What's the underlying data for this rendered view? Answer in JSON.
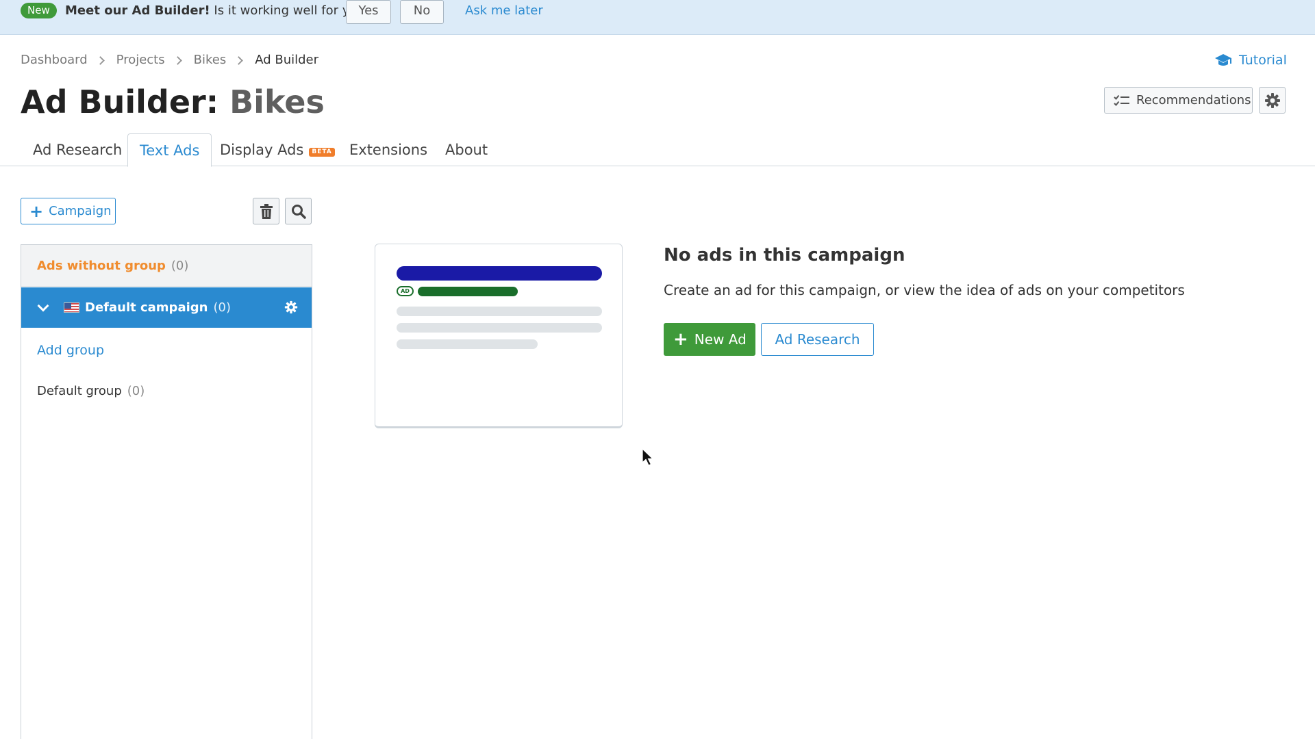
{
  "banner": {
    "badge": "New",
    "title": "Meet our Ad Builder!",
    "question": "Is it working well for you?",
    "yes_label": "Yes",
    "no_label": "No",
    "later_label": "Ask me later"
  },
  "breadcrumb": [
    "Dashboard",
    "Projects",
    "Bikes",
    "Ad Builder"
  ],
  "tutorial_label": "Tutorial",
  "page": {
    "title": "Ad Builder:",
    "project": "Bikes"
  },
  "header_buttons": {
    "recommendations_label": "Recommendations"
  },
  "tabs": [
    {
      "label": "Ad Research",
      "active": false
    },
    {
      "label": "Text Ads",
      "active": true
    },
    {
      "label": "Display Ads",
      "badge": "BETA",
      "active": false
    },
    {
      "label": "Extensions",
      "active": false
    },
    {
      "label": "About",
      "active": false
    }
  ],
  "toolbar": {
    "campaign_label": "Campaign"
  },
  "sidebar": {
    "ads_without_group": {
      "label": "Ads without group",
      "count": "(0)"
    },
    "campaign": {
      "label": "Default campaign",
      "count": "(0)"
    },
    "add_group_label": "Add group",
    "groups": [
      {
        "label": "Default group",
        "count": "(0)"
      }
    ]
  },
  "illustration": {
    "ad_tag": "AD"
  },
  "empty_state": {
    "title": "No ads in this campaign",
    "description": "Create an ad for this campaign, or view the idea of ads on your competitors",
    "new_ad_label": "New Ad",
    "ad_research_label": "Ad Research"
  },
  "colors": {
    "accent": "#2a8ad0",
    "green": "#3f9a3a",
    "orange": "#f08c2e",
    "banner_bg": "#dcebf8",
    "ad_title": "#1a1aa6",
    "ad_url": "#1a6e2b"
  },
  "icons": [
    "graduation-cap-icon",
    "checklist-icon",
    "gear-icon",
    "plus-icon",
    "trash-icon",
    "search-icon",
    "chevron-down-icon",
    "us-flag-icon",
    "cursor-icon"
  ]
}
